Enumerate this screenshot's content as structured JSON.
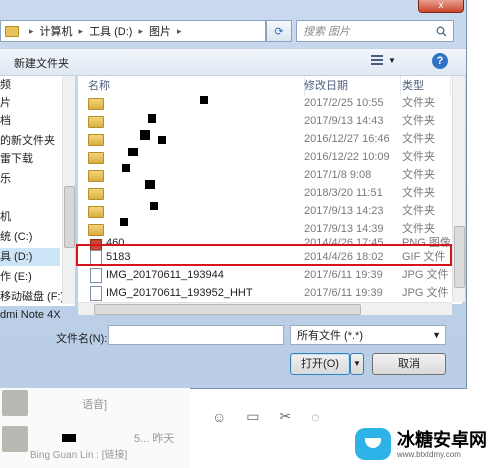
{
  "window": {
    "close_label": "x"
  },
  "breadcrumb": {
    "items": [
      "计算机",
      "工具 (D:)",
      "图片"
    ]
  },
  "search": {
    "placeholder": "搜索 图片"
  },
  "toolbar": {
    "new_folder_label": "新建文件夹",
    "help_label": "?"
  },
  "nav": {
    "items": [
      "频",
      "片",
      "档",
      "的新文件夹",
      "雷下载",
      "乐",
      "机",
      "统 (C:)",
      "具 (D:)",
      "作 (E:)",
      "移动磁盘 (F:)",
      "dmi Note 4X"
    ]
  },
  "columns": {
    "name": "名称",
    "date": "修改日期",
    "type": "类型"
  },
  "files": [
    {
      "name": "",
      "date": "2017/2/25 10:55",
      "type": "文件夹",
      "icon": "folder-icon"
    },
    {
      "name": "",
      "date": "2017/9/13 14:43",
      "type": "文件夹",
      "icon": "folder-icon"
    },
    {
      "name": "",
      "date": "2016/12/27 16:46",
      "type": "文件夹",
      "icon": "folder-icon"
    },
    {
      "name": "",
      "date": "2016/12/22 10:09",
      "type": "文件夹",
      "icon": "folder-icon"
    },
    {
      "name": "",
      "date": "2017/1/8 9:08",
      "type": "文件夹",
      "icon": "folder-icon"
    },
    {
      "name": "",
      "date": "2018/3/20 11:51",
      "type": "文件夹",
      "icon": "folder-icon"
    },
    {
      "name": "",
      "date": "2017/9/13 14:23",
      "type": "文件夹",
      "icon": "folder-icon"
    },
    {
      "name": "",
      "date": "2017/9/13 14:39",
      "type": "文件夹",
      "icon": "folder-icon"
    },
    {
      "name": "460",
      "date": "2014/4/26 17:45",
      "type": "PNG 图像",
      "icon": "png-file-icon"
    },
    {
      "name": "5183",
      "date": "2014/4/26 18:02",
      "type": "GIF 文件",
      "icon": "gif-file-icon"
    },
    {
      "name": "IMG_20170611_193944",
      "date": "2017/6/11 19:39",
      "type": "JPG 文件",
      "icon": "jpg-file-icon"
    },
    {
      "name": "IMG_20170611_193952_HHT",
      "date": "2017/6/11 19:39",
      "type": "JPG 文件",
      "icon": "jpg-file-icon"
    }
  ],
  "footer": {
    "filename_label": "文件名(N):",
    "filename_value": "",
    "filter_value": "所有文件 (*.*)",
    "open_label": "打开(O)",
    "cancel_label": "取消"
  },
  "chat": {
    "row1_text": "语音]",
    "row2_text": "5...  昨天",
    "row3_text": "Bing  Guan  Lin : [链接]"
  },
  "watermark": {
    "title": "冰糖安卓网",
    "url": "www.btxtdmy.com"
  },
  "colors": {
    "highlight": "#d4161c",
    "accent": "#2f73c7"
  }
}
